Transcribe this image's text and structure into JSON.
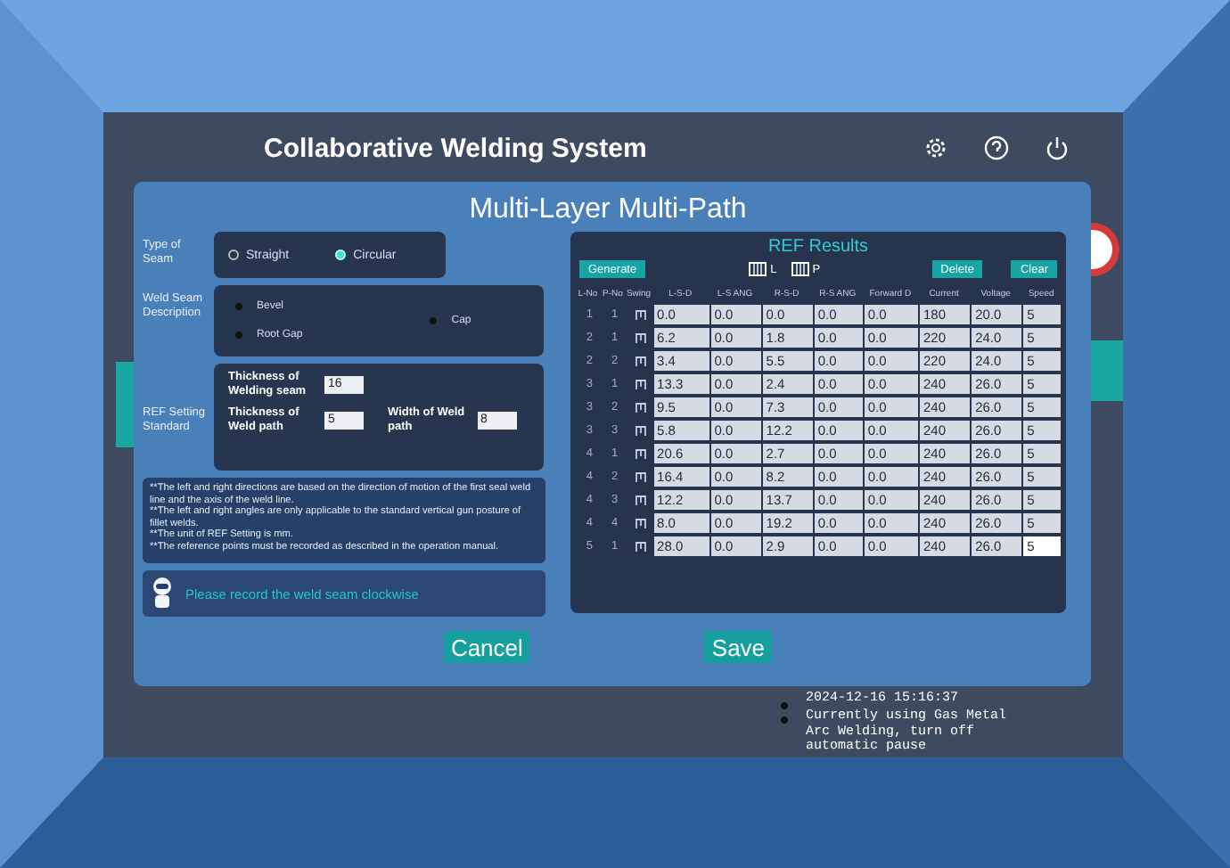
{
  "header": {
    "title": "Collaborative Welding System"
  },
  "dialog": {
    "title": "Multi-Layer Multi-Path",
    "seam_type": {
      "label": "Type of Seam",
      "options": [
        {
          "label": "Straight",
          "selected": false
        },
        {
          "label": "Circular",
          "selected": true
        }
      ]
    },
    "seam_description": {
      "label": "Weld Seam Description",
      "items": [
        "Bevel",
        "Root Gap",
        "Cap"
      ]
    },
    "ref_setting": {
      "label": "REF Setting Standard",
      "fields": [
        {
          "label": "Thickness of Welding seam",
          "value": "16"
        },
        {
          "label": "Thickness of Weld path",
          "value": "5"
        },
        {
          "label": "Width of Weld path",
          "value": "8"
        }
      ]
    },
    "notes": [
      "**The left and right directions are based on the direction of motion of the first seal weld line and the axis of the weld line.",
      "**The left and right angles are only applicable to the standard vertical gun posture of fillet welds.",
      "**The unit of REF Setting is mm.",
      "**The reference points must be recorded as described in the operation manual."
    ],
    "hint": "Please record the weld seam clockwise",
    "results": {
      "title": "REF Results",
      "generate": "Generate",
      "toggles": [
        "L",
        "P"
      ],
      "actions": [
        "Delete",
        "Clear"
      ],
      "columns": [
        "L-No",
        "P-No",
        "Swing",
        "L-S-D",
        "L-S ANG",
        "R-S-D",
        "R-S ANG",
        "Forward D",
        "Current",
        "Voltage",
        "Speed"
      ],
      "rows": [
        {
          "l_no": "1",
          "p_no": "1",
          "values": [
            "0.0",
            "0.0",
            "0.0",
            "0.0",
            "0.0",
            "180",
            "20.0",
            "5"
          ],
          "editing": false
        },
        {
          "l_no": "2",
          "p_no": "1",
          "values": [
            "6.2",
            "0.0",
            "1.8",
            "0.0",
            "0.0",
            "220",
            "24.0",
            "5"
          ],
          "editing": false
        },
        {
          "l_no": "2",
          "p_no": "2",
          "values": [
            "3.4",
            "0.0",
            "5.5",
            "0.0",
            "0.0",
            "220",
            "24.0",
            "5"
          ],
          "editing": false
        },
        {
          "l_no": "3",
          "p_no": "1",
          "values": [
            "13.3",
            "0.0",
            "2.4",
            "0.0",
            "0.0",
            "240",
            "26.0",
            "5"
          ],
          "editing": false
        },
        {
          "l_no": "3",
          "p_no": "2",
          "values": [
            "9.5",
            "0.0",
            "7.3",
            "0.0",
            "0.0",
            "240",
            "26.0",
            "5"
          ],
          "editing": false
        },
        {
          "l_no": "3",
          "p_no": "3",
          "values": [
            "5.8",
            "0.0",
            "12.2",
            "0.0",
            "0.0",
            "240",
            "26.0",
            "5"
          ],
          "editing": false
        },
        {
          "l_no": "4",
          "p_no": "1",
          "values": [
            "20.6",
            "0.0",
            "2.7",
            "0.0",
            "0.0",
            "240",
            "26.0",
            "5"
          ],
          "editing": false
        },
        {
          "l_no": "4",
          "p_no": "2",
          "values": [
            "16.4",
            "0.0",
            "8.2",
            "0.0",
            "0.0",
            "240",
            "26.0",
            "5"
          ],
          "editing": false
        },
        {
          "l_no": "4",
          "p_no": "3",
          "values": [
            "12.2",
            "0.0",
            "13.7",
            "0.0",
            "0.0",
            "240",
            "26.0",
            "5"
          ],
          "editing": false
        },
        {
          "l_no": "4",
          "p_no": "4",
          "values": [
            "8.0",
            "0.0",
            "19.2",
            "0.0",
            "0.0",
            "240",
            "26.0",
            "5"
          ],
          "editing": false
        },
        {
          "l_no": "5",
          "p_no": "1",
          "values": [
            "28.0",
            "0.0",
            "2.9",
            "0.0",
            "0.0",
            "240",
            "26.0",
            "5"
          ],
          "editing": true
        }
      ]
    },
    "buttons": [
      "Cancel",
      "Save"
    ]
  },
  "log": [
    {
      "time": "2024-12-16 15:16:37",
      "message": "Currently using Gas Metal Arc Welding, turn off automatic pause"
    }
  ]
}
